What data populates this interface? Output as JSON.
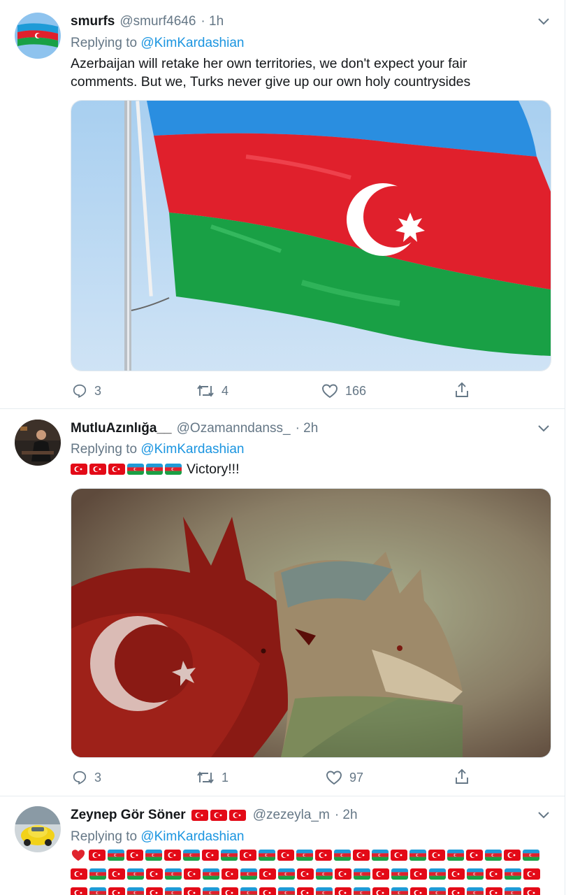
{
  "tweets": [
    {
      "name": "smurfs",
      "handle": "@smurf4646",
      "time": "· 1h",
      "replying_prefix": "Replying to",
      "replying_to": "@KimKardashian",
      "text_line1": "Azerbaijan will retake her own territories, we don't expect your fair",
      "text_line2": "comments. But we, Turks never give up our own holy countrysides",
      "media": "azerbaijan-flag-photo",
      "replies": "3",
      "retweets": "4",
      "likes": "166"
    },
    {
      "name": "MutluAzınlığa__",
      "handle": "@Ozamanndanss_",
      "time": "· 2h",
      "replying_prefix": "Replying to",
      "replying_to": "@KimKardashian",
      "text": "Victory!!!",
      "flags": [
        "turkey-flag",
        "turkey-flag",
        "turkey-flag",
        "azerbaijan-flag",
        "azerbaijan-flag",
        "azerbaijan-flag"
      ],
      "media": "wolves-painting",
      "replies": "3",
      "retweets": "1",
      "likes": "97"
    },
    {
      "name": "Zeynep Gör Söner",
      "handle": "@zezeyla_m",
      "time": "· 2h",
      "replying_prefix": "Replying to",
      "replying_to": "@KimKardashian",
      "name_flags": [
        "turkey-flag",
        "turkey-flag",
        "turkey-flag"
      ],
      "text_prefix_icon": "heart-emoji",
      "text_flag_pattern": [
        "turkey-flag",
        "azerbaijan-flag"
      ]
    }
  ],
  "colors": {
    "link": "#1b95e0",
    "secondary_text": "#657786",
    "divider": "#e6ecf0",
    "turkey_red": "#e30a17",
    "az_blue": "#1e9bd7",
    "az_red": "#e0202c",
    "az_green": "#19a045"
  },
  "icons": [
    "reply-icon",
    "retweet-icon",
    "like-icon",
    "share-icon",
    "caret-down-icon"
  ]
}
